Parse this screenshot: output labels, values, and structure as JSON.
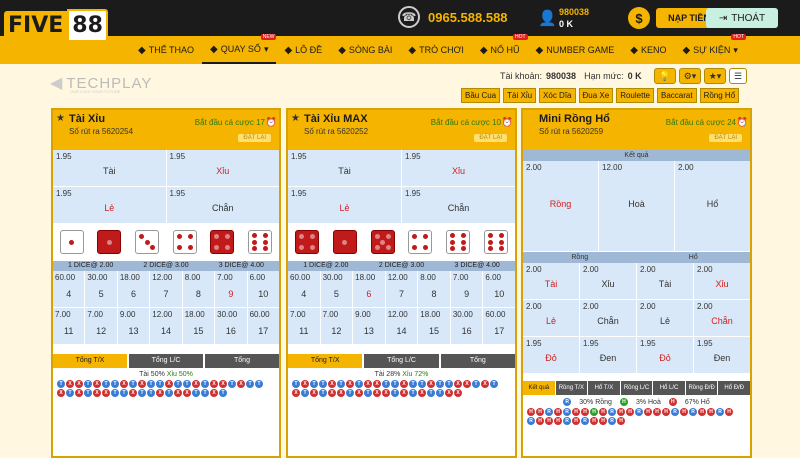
{
  "brand": {
    "part1": "FIVE",
    "part2": "88"
  },
  "header": {
    "phone": "0965.588.588",
    "user_id": "980038",
    "balance": "0 K",
    "deposit_label": "NẠP TIỀN",
    "logout_label": "THOÁT"
  },
  "nav": [
    {
      "label": "THỂ THAO",
      "icon": "sports-icon"
    },
    {
      "label": "QUAY SỐ",
      "icon": "dice-icon",
      "tag": "NEW",
      "caret": true,
      "active": true
    },
    {
      "label": "LÔ ĐỀ",
      "icon": "lottery-icon"
    },
    {
      "label": "SÒNG BÀI",
      "icon": "casino-icon"
    },
    {
      "label": "TRÒ CHƠI",
      "icon": "gamepad-icon"
    },
    {
      "label": "NỔ HŨ",
      "icon": "jackpot-icon",
      "tag": "HOT"
    },
    {
      "label": "NUMBER GAME",
      "icon": "number-icon"
    },
    {
      "label": "KENO",
      "icon": "keno-icon"
    },
    {
      "label": "SỰ KIỆN",
      "icon": "gift-icon",
      "tag": "HOT",
      "caret": true
    }
  ],
  "techplay": {
    "name": "TECHPLAY",
    "tagline": "OUR LUCK YOUR FUTURE"
  },
  "account": {
    "label": "Tài khoản:",
    "id": "980038",
    "limit_label": "Hạn mức:",
    "limit": "0 K"
  },
  "game_tabs": [
    "Bầu Cua",
    "Tài Xỉu",
    "Xóc Dĩa",
    "Đua Xe",
    "Roulette",
    "Baccarat",
    "Rồng Hổ"
  ],
  "panels": [
    {
      "title": "Tài Xỉu",
      "draw": "Số rút ra 5620254",
      "countdown": "Bắt đầu cá cược 17",
      "cancel": "ĐẶT LẠI",
      "bets": [
        {
          "odds": "1.95",
          "name": "Tài",
          "red": false
        },
        {
          "odds": "1.95",
          "name": "Xỉu",
          "red": true
        },
        {
          "odds": "1.95",
          "name": "Lẻ",
          "red": true
        },
        {
          "odds": "1.95",
          "name": "Chẵn",
          "red": false
        }
      ],
      "dice": [
        1,
        1,
        3,
        4,
        4,
        6
      ],
      "dice_red": [
        false,
        true,
        false,
        false,
        true,
        false
      ],
      "dice_hdr": [
        "1 DICE@ 2.00",
        "2 DICE@ 3.00",
        "3 DICE@ 4.00"
      ],
      "nums": [
        {
          "o": "60.00",
          "n": "4"
        },
        {
          "o": "30.00",
          "n": "5"
        },
        {
          "o": "18.00",
          "n": "6"
        },
        {
          "o": "12.00",
          "n": "7"
        },
        {
          "o": "8.00",
          "n": "8"
        },
        {
          "o": "7.00",
          "n": "9"
        },
        {
          "o": "6.00",
          "n": "10"
        },
        {
          "o": "7.00",
          "n": "11"
        },
        {
          "o": "7.00",
          "n": "12"
        },
        {
          "o": "9.00",
          "n": "13"
        },
        {
          "o": "12.00",
          "n": "14"
        },
        {
          "o": "18.00",
          "n": "15"
        },
        {
          "o": "30.00",
          "n": "16"
        },
        {
          "o": "60.00",
          "n": "17"
        }
      ],
      "tabs": [
        "Tổng T/X",
        "Tổng L/C",
        "Tổng"
      ],
      "stat_a": "Tài 50%",
      "stat_b": "Xỉu 50%"
    },
    {
      "title": "Tài Xỉu MAX",
      "draw": "Số rút ra 5620252",
      "countdown": "Bắt đầu cá cược 10",
      "cancel": "ĐẶT LẠI",
      "bets": [
        {
          "odds": "1.95",
          "name": "Tài",
          "red": false
        },
        {
          "odds": "1.95",
          "name": "Xỉu",
          "red": true
        },
        {
          "odds": "1.95",
          "name": "Lẻ",
          "red": true
        },
        {
          "odds": "1.95",
          "name": "Chẵn",
          "red": false
        }
      ],
      "dice": [
        4,
        1,
        5,
        4,
        6,
        6
      ],
      "dice_red": [
        true,
        true,
        true,
        false,
        false,
        false
      ],
      "dice_hdr": [
        "1 DICE@ 2.00",
        "2 DICE@ 3.00",
        "3 DICE@ 4.00"
      ],
      "nums": [
        {
          "o": "60.00",
          "n": "4"
        },
        {
          "o": "30.00",
          "n": "5"
        },
        {
          "o": "18.00",
          "n": "6"
        },
        {
          "o": "12.00",
          "n": "7"
        },
        {
          "o": "8.00",
          "n": "8"
        },
        {
          "o": "7.00",
          "n": "9"
        },
        {
          "o": "6.00",
          "n": "10"
        },
        {
          "o": "7.00",
          "n": "11"
        },
        {
          "o": "7.00",
          "n": "12"
        },
        {
          "o": "9.00",
          "n": "13"
        },
        {
          "o": "12.00",
          "n": "14"
        },
        {
          "o": "18.00",
          "n": "15"
        },
        {
          "o": "30.00",
          "n": "16"
        },
        {
          "o": "60.00",
          "n": "17"
        }
      ],
      "tabs": [
        "Tổng T/X",
        "Tổng L/C",
        "Tổng"
      ],
      "stat_a": "Tài 28%",
      "stat_b": "Xỉu 72%"
    }
  ],
  "rh": {
    "title": "Mini Rồng Hổ",
    "draw": "Số rút ra 5620259",
    "countdown": "Bắt đầu cá cược 24",
    "cancel": "ĐẶT LẠI",
    "result_label": "Kết quả",
    "main": [
      {
        "odds": "2.00",
        "name": "Rồng"
      },
      {
        "odds": "12.00",
        "name": "Hoà"
      },
      {
        "odds": "2.00",
        "name": "Hổ"
      }
    ],
    "sides": [
      "Rồng",
      "Hổ"
    ],
    "cells": [
      {
        "o": "2.00",
        "n": "Tài",
        "r": true
      },
      {
        "o": "2.00",
        "n": "Xỉu",
        "r": false
      },
      {
        "o": "2.00",
        "n": "Tài",
        "r": false
      },
      {
        "o": "2.00",
        "n": "Xỉu",
        "r": true
      },
      {
        "o": "2.00",
        "n": "Lẻ",
        "r": true
      },
      {
        "o": "2.00",
        "n": "Chẵn",
        "r": false
      },
      {
        "o": "2.00",
        "n": "Lẻ",
        "r": false
      },
      {
        "o": "2.00",
        "n": "Chẵn",
        "r": true
      },
      {
        "o": "1.95",
        "n": "Đỏ",
        "r": true
      },
      {
        "o": "1.95",
        "n": "Đen",
        "r": false
      },
      {
        "o": "1.95",
        "n": "Đỏ",
        "r": true
      },
      {
        "o": "1.95",
        "n": "Đen",
        "r": false
      }
    ],
    "tabs": [
      "Kết quả",
      "Rồng T/X",
      "Hổ T/X",
      "Rồng L/C",
      "Hổ L/C",
      "Rồng Đ/Đ",
      "Hổ Đ/Đ"
    ],
    "stat_r": "30% Rồng",
    "stat_h": "3% Hoà",
    "stat_t": "67% Hổ"
  },
  "colors": {
    "gold": "#f5b400",
    "dark": "#1b1b1b",
    "cell": "#d8e8f8",
    "red": "#d02020",
    "green": "#2a7a10"
  }
}
